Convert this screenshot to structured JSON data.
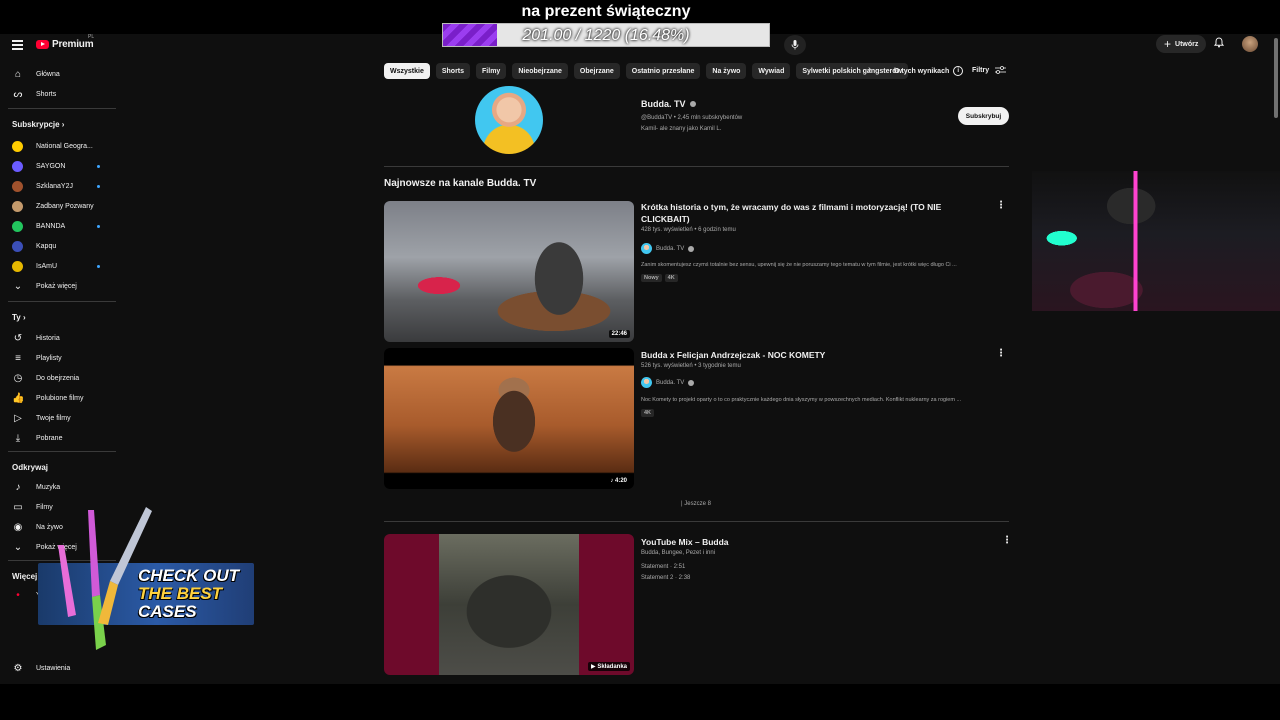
{
  "overlay": {
    "goal_title": "na prezent świąteczny",
    "goal_text": "201.00 / 1220 (16.48%)",
    "goal_fraction": 0.1648
  },
  "header": {
    "logo_text": "Premium",
    "logo_sup": "PL",
    "create_label": "Utwórz"
  },
  "sidebar": {
    "main": [
      {
        "label": "Główna",
        "icon": "home-icon"
      },
      {
        "label": "Shorts",
        "icon": "shorts-icon"
      }
    ],
    "subscriptions_title": "Subskrypcje",
    "subscriptions": [
      {
        "label": "National Geogra...",
        "color": "#ffcc00"
      },
      {
        "label": "SAYGON",
        "color": "#6b5cff"
      },
      {
        "label": "SzklanaY2J",
        "color": "#a0522d"
      },
      {
        "label": "Zadbany Pozwany",
        "color": "#c49a6c"
      },
      {
        "label": "BANNDA",
        "color": "#22c55e"
      },
      {
        "label": "Kapqu",
        "color": "#3b4fb8"
      },
      {
        "label": "IsAmU",
        "color": "#e6b800"
      }
    ],
    "show_more": "Pokaż więcej",
    "you_title": "Ty",
    "you_items": [
      {
        "label": "Historia",
        "icon": "history-icon"
      },
      {
        "label": "Playlisty",
        "icon": "playlist-icon"
      },
      {
        "label": "Do obejrzenia",
        "icon": "watch-later-icon"
      },
      {
        "label": "Polubione filmy",
        "icon": "like-icon"
      },
      {
        "label": "Twoje filmy",
        "icon": "your-videos-icon"
      },
      {
        "label": "Pobrane",
        "icon": "download-icon"
      }
    ],
    "explore_title": "Odkrywaj",
    "explore_items": [
      {
        "label": "Muzyka",
        "icon": "music-icon"
      },
      {
        "label": "Filmy",
        "icon": "movies-icon"
      },
      {
        "label": "Na żywo",
        "icon": "live-icon"
      },
      {
        "label": "Pokaż więcej",
        "icon": "chevron-down-icon"
      }
    ],
    "more_title": "Więcej z YouTube",
    "more_items": [
      {
        "label": "YouTube Studio"
      }
    ],
    "settings": "Ustawienia"
  },
  "chips": [
    "Wszystkie",
    "Shorts",
    "Filmy",
    "Nieobejrzane",
    "Obejrzane",
    "Ostatnio przesłane",
    "Na żywo",
    "Wywiad",
    "Sylwetki polskich gangsterów"
  ],
  "about_results": "O tych wynikach",
  "filters": "Filtry",
  "channel": {
    "name": "Budda. TV",
    "meta": "@BuddaTV • 2,45 mln subskrybentów",
    "desc": "Kamil- ale znany jako Kamil L.",
    "subscribe": "Subskrybuj"
  },
  "section_title": "Najnowsze na kanale Budda. TV",
  "videos": [
    {
      "title": "Krótka historia o tym, że wracamy do was z filmami i motoryzacją! (TO NIE CLICKBAIT)",
      "meta": "428 tys. wyświetleń • 6 godzin temu",
      "channel": "Budda. TV",
      "desc": "Zanim skomentujesz czymś totalnie bez sensu, upewnij się że nie poruszamy tego tematu w tym filmie, jest krótki więc długo Ci ...",
      "badges": [
        "Nowy",
        "4K"
      ],
      "duration": "22:46"
    },
    {
      "title": "Budda x Felicjan Andrzejczak - NOC KOMETY",
      "meta": "526 tys. wyświetleń • 3 tygodnie temu",
      "channel": "Budda. TV",
      "desc": "Noc Komety to projekt oparty o to co praktycznie każdego dnia słyszymy w powszechnych mediach. Konflikt nuklearny za rogiem ...",
      "badges": [
        "4K"
      ],
      "duration": "4:20"
    }
  ],
  "more_link": "| Jeszcze 8",
  "mix": {
    "title": "YouTube Mix – Budda",
    "sub": "Budda, Bungee, Pezet i inni",
    "items": [
      "Statement · 2:51",
      "Statement 2 · 2:38"
    ],
    "badge": "Składanka"
  },
  "ad": {
    "line1": "CHECK OUT",
    "line2": "THE BEST",
    "line3": "CASES"
  }
}
